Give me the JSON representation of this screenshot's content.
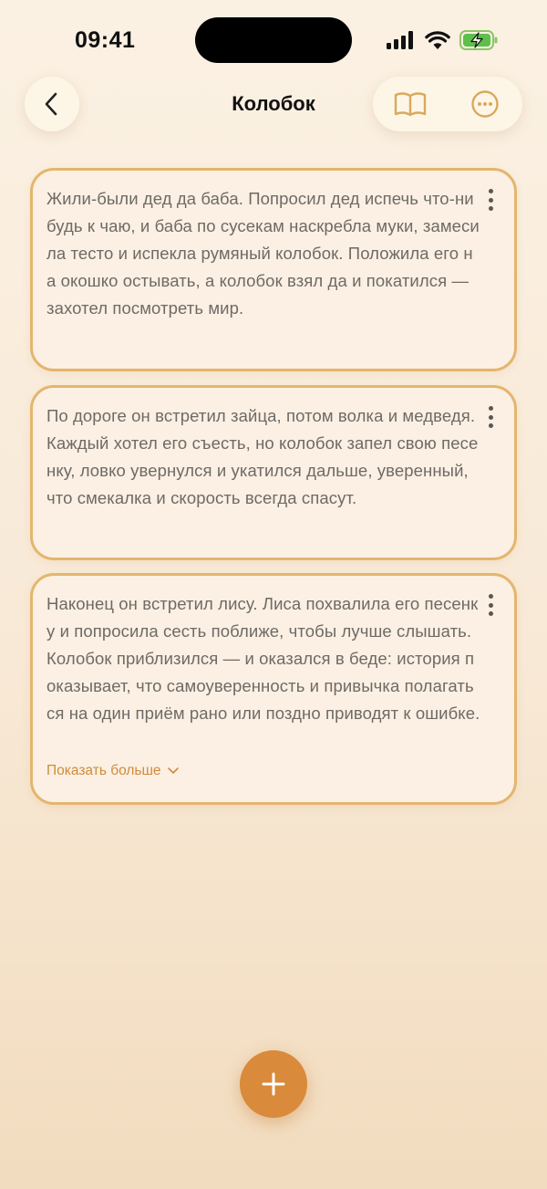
{
  "status_bar": {
    "time": "09:41"
  },
  "nav": {
    "title": "Колобок",
    "icons": [
      "chevron-left-icon",
      "book-icon",
      "more-horizontal-icon"
    ]
  },
  "colors": {
    "accent": "#d98a3a",
    "card_border": "#e4b56e",
    "card_bg": "#fbf0e3",
    "text_muted": "#6f6a66",
    "link": "#d08b3b"
  },
  "cards": [
    {
      "text": "Жили-были дед да баба. Попросил дед испечь что-нибудь к чаю, и баба по сусекам наскребла муки, замесила тесто и испекла румяный колобок. Положила его на окошко остывать, а колобок взял да и покатился — захотел посмотреть мир."
    },
    {
      "text": "По дороге он встретил зайца, потом волка и медведя. Каждый хотел его съесть, но колобок запел свою песенку, ловко увернулся и укатился дальше, уверенный, что смекалка и скорость всегда спасут."
    },
    {
      "text": "Наконец он встретил лису. Лиса похвалила его песенку и попросила сесть поближе, чтобы лучше слышать. Колобок приблизился — и оказался в беде: история показывает, что самоуверенность и привычка полагаться на один приём рано или поздно приводят к ошибке.",
      "show_more": "Показать больше"
    }
  ]
}
